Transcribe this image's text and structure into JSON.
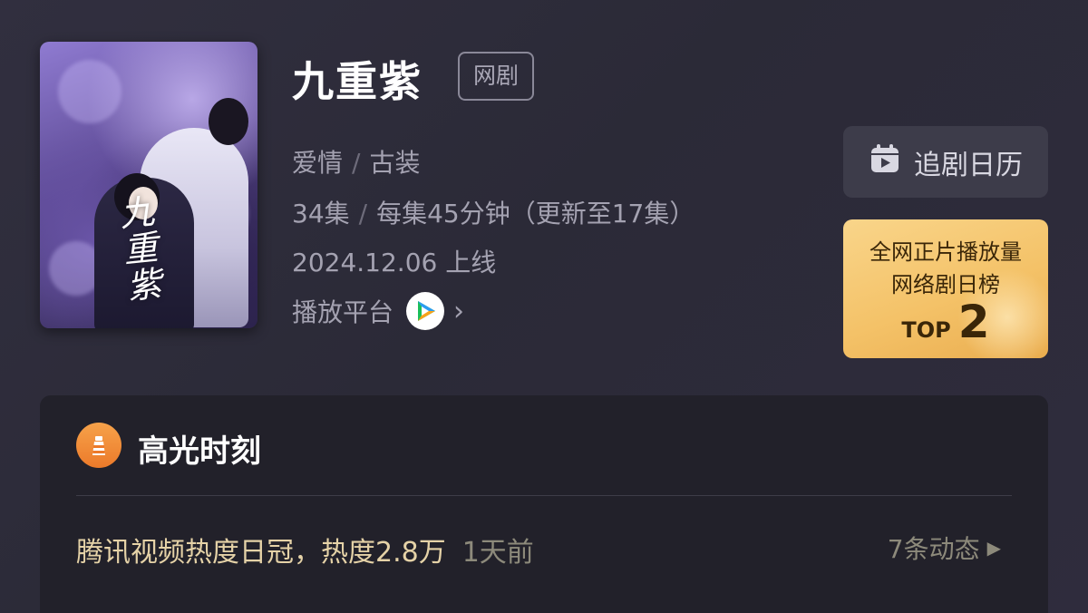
{
  "show": {
    "title": "九重紫",
    "type_badge": "网剧",
    "genres": [
      "爱情",
      "古装"
    ],
    "genre_separator": "/",
    "episodes": "34集",
    "episode_info": "每集45分钟（更新至17集）",
    "release": "2024.12.06 上线",
    "platform_label": "播放平台",
    "platform_icon": "tencent-video-icon",
    "poster_calligraphy": "九重紫"
  },
  "actions": {
    "calendar_label": "追剧日历",
    "calendar_icon": "calendar-icon"
  },
  "rank": {
    "line1": "全网正片播放量",
    "line2": "网络剧日榜",
    "top_label": "TOP",
    "top_number": "2"
  },
  "highlight": {
    "title": "高光时刻",
    "icon": "lighthouse-icon",
    "event": "腾讯视频热度日冠，热度2.8万",
    "time": "1天前",
    "more": "7条动态"
  },
  "colors": {
    "background": "#2d2c39",
    "card": "#22212a",
    "rank_gold": "#f4c268",
    "highlight_text": "#e5d2a7",
    "accent_orange": "#ec7a2a"
  }
}
